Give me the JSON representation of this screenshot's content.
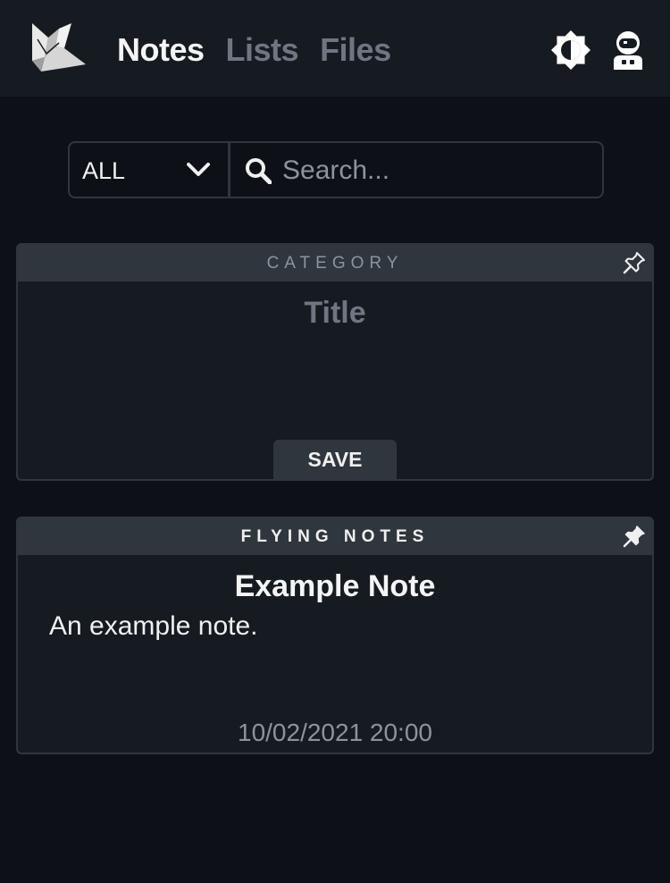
{
  "header": {
    "nav": [
      {
        "label": "Notes",
        "active": true
      },
      {
        "label": "Lists",
        "active": false
      },
      {
        "label": "Files",
        "active": false
      }
    ],
    "icons": [
      "logo-icon",
      "theme-toggle-icon",
      "user-avatar-icon"
    ]
  },
  "filter": {
    "selected": "ALL",
    "search_placeholder": "Search...",
    "search_value": ""
  },
  "new_note": {
    "category_placeholder": "CATEGORY",
    "title_placeholder": "Title",
    "save_label": "SAVE",
    "pinned": false
  },
  "notes": [
    {
      "category": "FLYING NOTES",
      "title": "Example Note",
      "body": "An example note.",
      "timestamp": "10/02/2021 20:00",
      "pinned": true
    }
  ],
  "colors": {
    "background": "#0d1117",
    "header": "#161b22",
    "card_header": "#30363d",
    "muted_text": "#8b949e"
  }
}
